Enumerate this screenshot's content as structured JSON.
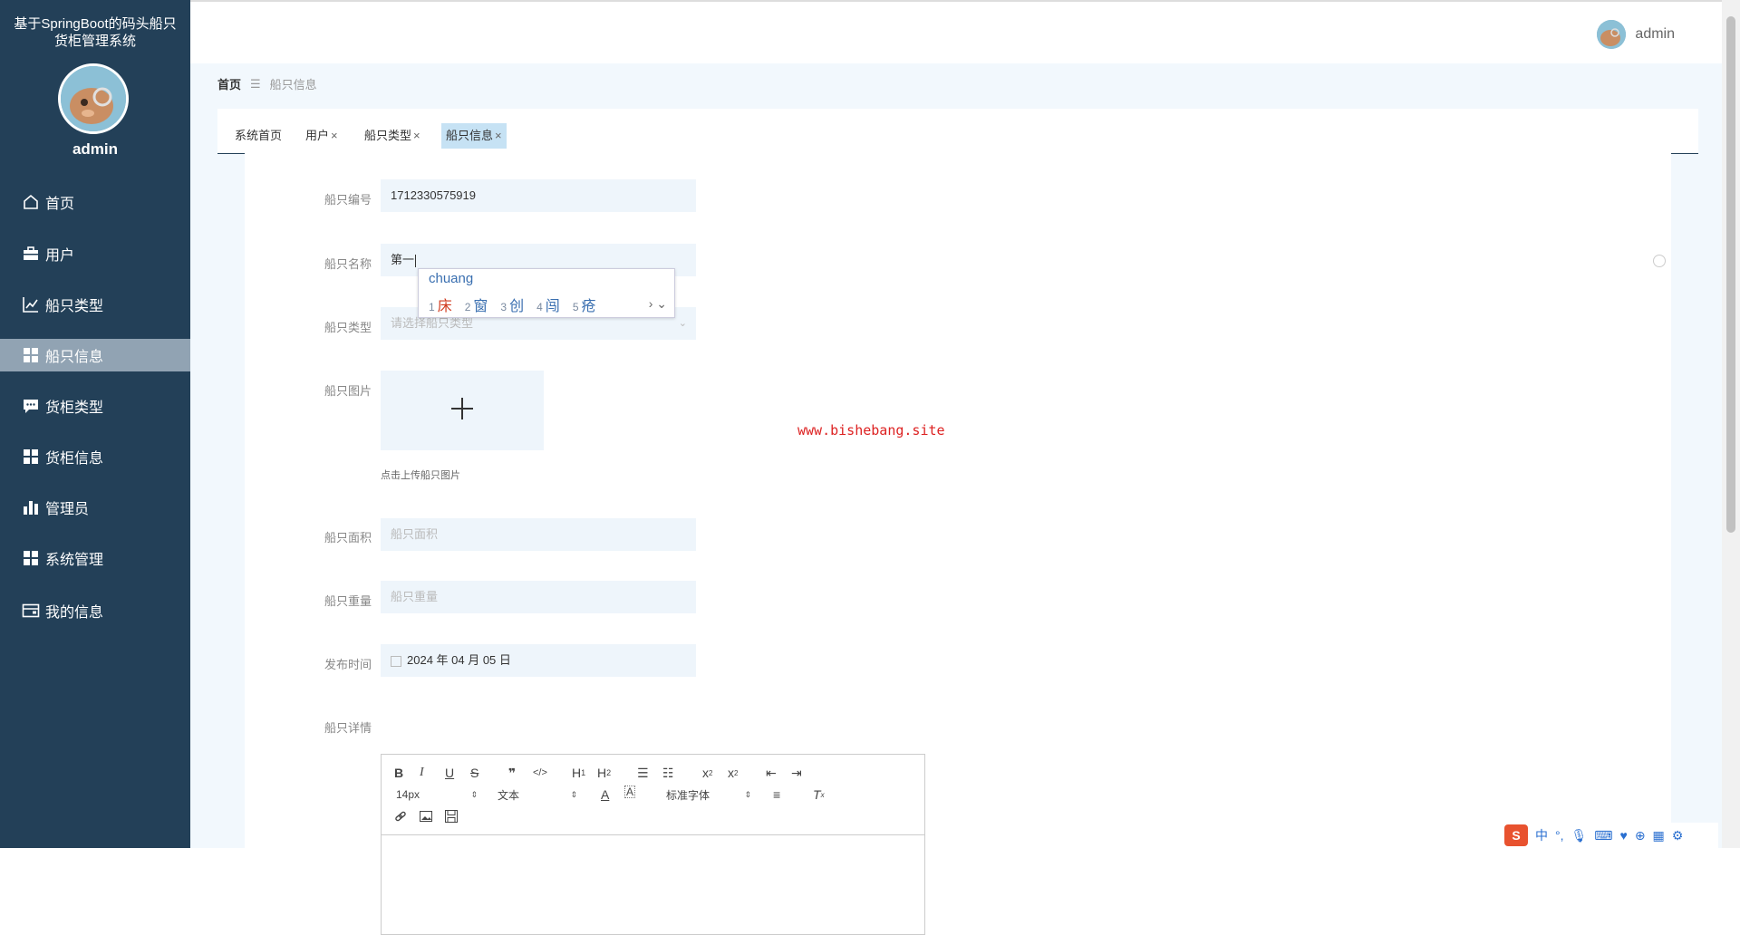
{
  "sidebar": {
    "title_line1": "基于SpringBoot的码头船只",
    "title_line2": "货柜管理系统",
    "username": "admin",
    "menu": [
      {
        "label": "首页",
        "icon": "home-icon"
      },
      {
        "label": "用户",
        "icon": "briefcase-icon"
      },
      {
        "label": "船只类型",
        "icon": "chart-line-icon"
      },
      {
        "label": "船只信息",
        "icon": "grid-icon",
        "active": true
      },
      {
        "label": "货柜类型",
        "icon": "chat-icon"
      },
      {
        "label": "货柜信息",
        "icon": "grid-icon"
      },
      {
        "label": "管理员",
        "icon": "bar-chart-icon"
      },
      {
        "label": "系统管理",
        "icon": "grid-icon"
      },
      {
        "label": "我的信息",
        "icon": "wallet-icon"
      }
    ]
  },
  "header": {
    "username": "admin"
  },
  "breadcrumb": {
    "home": "首页",
    "separator": "☰",
    "current": "船只信息"
  },
  "tabs": [
    {
      "label": "系统首页",
      "closable": false
    },
    {
      "label": "用户",
      "closable": true
    },
    {
      "label": "船只类型",
      "closable": true
    },
    {
      "label": "船只信息",
      "closable": true,
      "active": true
    }
  ],
  "form": {
    "ship_no": {
      "label": "船只编号",
      "value": "1712330575919"
    },
    "ship_name": {
      "label": "船只名称",
      "value": "第一"
    },
    "ship_type": {
      "label": "船只类型",
      "placeholder": "请选择船只类型"
    },
    "ship_image": {
      "label": "船只图片",
      "hint": "点击上传船只图片"
    },
    "ship_area": {
      "label": "船只面积",
      "placeholder": "船只面积"
    },
    "ship_weight": {
      "label": "船只重量",
      "placeholder": "船只重量"
    },
    "publish_time": {
      "label": "发布时间",
      "value": "2024 年 04 月 05 日"
    },
    "ship_detail": {
      "label": "船只详情"
    }
  },
  "ime": {
    "composition": "chuang",
    "candidates": [
      {
        "n": "1",
        "text": "床"
      },
      {
        "n": "2",
        "text": "窗"
      },
      {
        "n": "3",
        "text": "创"
      },
      {
        "n": "4",
        "text": "闯"
      },
      {
        "n": "5",
        "text": "疮"
      }
    ]
  },
  "editor": {
    "font_size": "14px",
    "header_select": "文本",
    "font_family": "标准字体"
  },
  "watermark": "www.bishebang.site",
  "tray": {
    "lang": "中"
  }
}
